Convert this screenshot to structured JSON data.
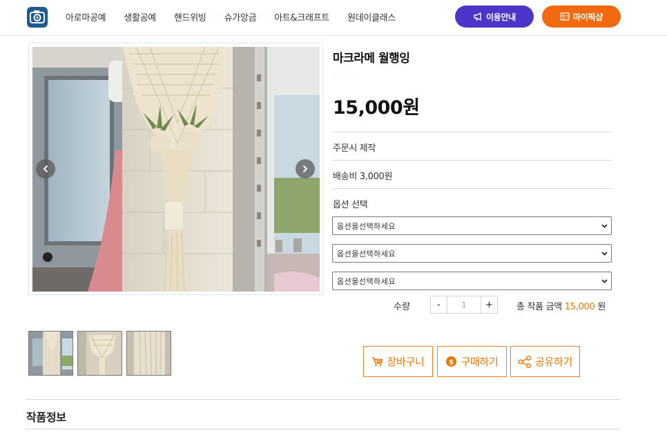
{
  "header": {
    "logo_icon": "camera-logo-icon",
    "nav": [
      "아로마공예",
      "생활공예",
      "핸드위빙",
      "슈가앙금",
      "아트&크래프트",
      "원데이클래스"
    ],
    "info_button": "이용안내",
    "info_icon": "megaphone-icon",
    "my_button": "마이픽샵",
    "my_icon": "id-card-icon",
    "colors": {
      "info": "#4b36c9",
      "my": "#f26a10"
    }
  },
  "product": {
    "title": "마크라메 월행잉",
    "subtitle_dots": "· · ·",
    "price": "15,000원",
    "made_to_order": "주문시 제작",
    "shipping": "배송비 3,000원",
    "option_label": "옵션 선택",
    "options": [
      {
        "placeholder": "옵션을선택하세요"
      },
      {
        "placeholder": "옵션을선택하세요"
      },
      {
        "placeholder": "옵션을선택하세요"
      }
    ],
    "quantity_label": "수량",
    "quantity_minus": "-",
    "quantity_value": "1",
    "quantity_plus": "+",
    "total_label": "총 작품 금액",
    "total_amount": "15,000",
    "total_unit": "원",
    "accent_color": "#f07300"
  },
  "actions": {
    "cart": "장바구니",
    "buy": "구매하기",
    "share": "공유하기"
  },
  "gallery": {
    "prev_icon": "chevron-left-icon",
    "next_icon": "chevron-right-icon",
    "thumbnail_count": 3
  },
  "section": {
    "info_title": "작품정보"
  }
}
